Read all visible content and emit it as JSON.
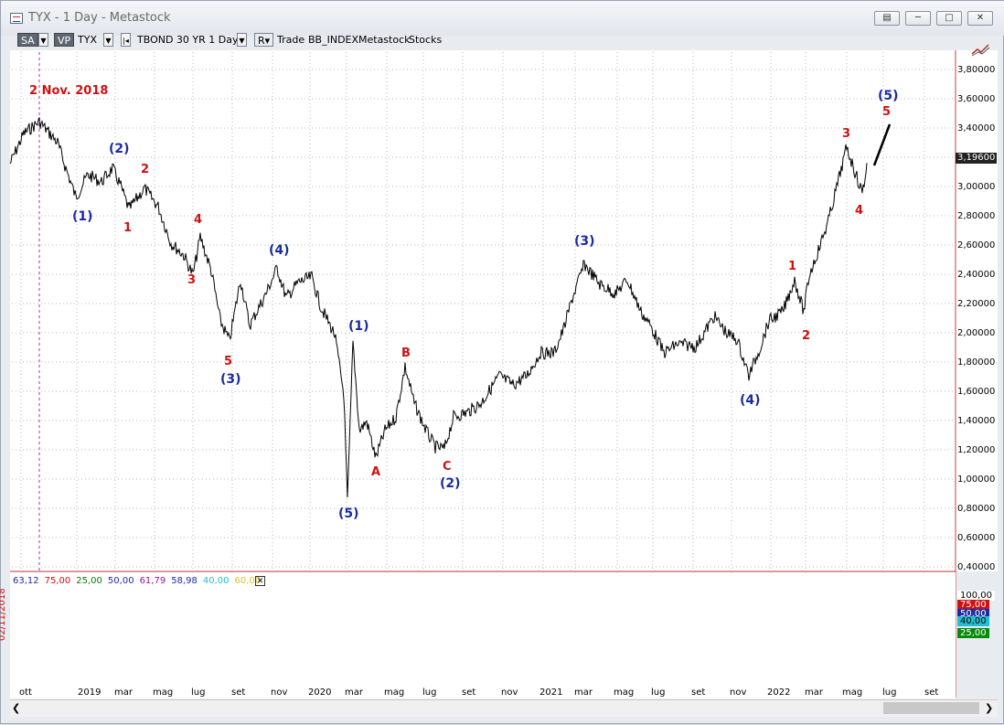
{
  "window": {
    "title": "TYX - 1 Day - Metastock"
  },
  "toolbar": {
    "sa": "SA",
    "vp": "VP",
    "symbol": "TYX",
    "chart_name": "TBOND 30 YR  1 Day",
    "r_btn": "R",
    "trade": "Trade",
    "index": "BB_INDEX",
    "source": "Metastock",
    "stocks": "Stocks"
  },
  "annotations": {
    "date_marker": "2 Nov. 2018",
    "vertical_date": "02/11/2018"
  },
  "price_axis": {
    "labels": [
      "3,80000",
      "3,60000",
      "3,40000",
      "3,20000",
      "3,00000",
      "2,80000",
      "2,60000",
      "2,40000",
      "2,20000",
      "2,00000",
      "1,80000",
      "1,60000",
      "1,40000",
      "1,20000",
      "1,00000",
      "0,80000",
      "0,60000",
      "0,40000"
    ],
    "current": "3,19600"
  },
  "time_axis": {
    "labels": [
      "ott",
      "2019",
      "mar",
      "mag",
      "lug",
      "set",
      "nov",
      "2020",
      "mar",
      "mag",
      "lug",
      "set",
      "nov",
      "2021",
      "mar",
      "mag",
      "lug",
      "set",
      "nov",
      "2022",
      "mar",
      "mag",
      "lug",
      "set"
    ]
  },
  "indicator": {
    "values": [
      {
        "text": "63,12",
        "color": "#1b2ba6"
      },
      {
        "text": "75,00",
        "color": "#d01010"
      },
      {
        "text": "25,00",
        "color": "#0a7a0a"
      },
      {
        "text": "50,00",
        "color": "#1b2ba6"
      },
      {
        "text": "61,79",
        "color": "#a0109a"
      },
      {
        "text": "58,98",
        "color": "#1b2ba6"
      },
      {
        "text": "40,00",
        "color": "#20c0d0"
      },
      {
        "text": "60,00",
        "color": "#e0c020"
      }
    ],
    "axis_labels": [
      {
        "text": "100,00",
        "bg": "#ffffff",
        "fg": "#000"
      },
      {
        "text": "75,00",
        "bg": "#d01010",
        "fg": "#fff"
      },
      {
        "text": "50,00",
        "bg": "#1b2ba6",
        "fg": "#fff"
      },
      {
        "text": "40,00",
        "bg": "#20c0d0",
        "fg": "#000"
      },
      {
        "text": "25,00",
        "bg": "#0a8a0a",
        "fg": "#fff"
      }
    ]
  },
  "waves": [
    {
      "text": "(1)",
      "color": "blue"
    },
    {
      "text": "(2)",
      "color": "blue"
    },
    {
      "text": "1",
      "color": "red"
    },
    {
      "text": "2",
      "color": "red"
    },
    {
      "text": "3",
      "color": "red"
    },
    {
      "text": "4",
      "color": "red"
    },
    {
      "text": "5",
      "color": "red"
    },
    {
      "text": "(3)",
      "color": "blue"
    },
    {
      "text": "(4)",
      "color": "blue"
    },
    {
      "text": "(5)",
      "color": "blue"
    },
    {
      "text": "(1)",
      "color": "blue"
    },
    {
      "text": "A",
      "color": "red"
    },
    {
      "text": "B",
      "color": "red"
    },
    {
      "text": "C",
      "color": "red"
    },
    {
      "text": "(2)",
      "color": "blue"
    },
    {
      "text": "(3)",
      "color": "blue"
    },
    {
      "text": "(4)",
      "color": "blue"
    },
    {
      "text": "1",
      "color": "red"
    },
    {
      "text": "2",
      "color": "red"
    },
    {
      "text": "3",
      "color": "red"
    },
    {
      "text": "4",
      "color": "red"
    },
    {
      "text": "(5)",
      "color": "blue"
    },
    {
      "text": "5",
      "color": "red"
    }
  ]
}
